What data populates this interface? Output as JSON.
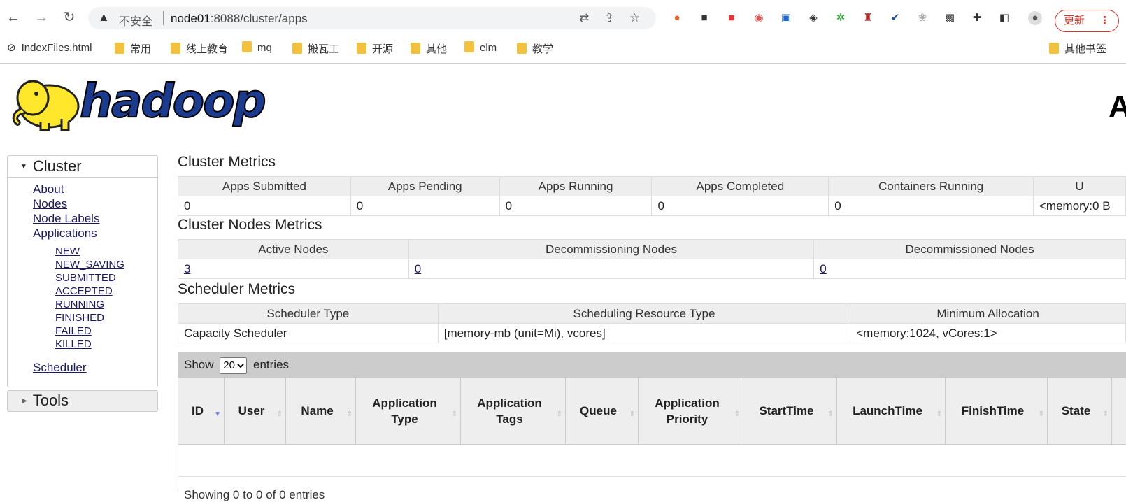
{
  "browser": {
    "back_icon": "←",
    "forward_icon": "→",
    "reload_icon": "↻",
    "insecure_label": "不安全",
    "url_host": "node01",
    "url_rest": ":8088/cluster/apps",
    "update_label": "更新",
    "bookmarks": [
      {
        "label": "IndexFiles.html",
        "icon": "globe-icon"
      },
      {
        "label": "常用",
        "icon": "folder-icon"
      },
      {
        "label": "线上教育",
        "icon": "folder-icon"
      },
      {
        "label": "mq",
        "icon": "folder-icon"
      },
      {
        "label": "搬瓦工",
        "icon": "folder-icon"
      },
      {
        "label": "开源",
        "icon": "folder-icon"
      },
      {
        "label": "其他",
        "icon": "folder-icon"
      },
      {
        "label": "elm",
        "icon": "folder-icon"
      },
      {
        "label": "教学",
        "icon": "folder-icon"
      }
    ],
    "other_bookmarks": "其他书签"
  },
  "page": {
    "logo_text": "hadoop",
    "title_fragment": "A"
  },
  "nav": {
    "cluster_header": "Cluster",
    "links": [
      "About",
      "Nodes",
      "Node Labels",
      "Applications"
    ],
    "app_states": [
      "NEW",
      "NEW_SAVING",
      "SUBMITTED",
      "ACCEPTED",
      "RUNNING",
      "FINISHED",
      "FAILED",
      "KILLED"
    ],
    "scheduler": "Scheduler",
    "tools_header": "Tools"
  },
  "cluster_metrics": {
    "title": "Cluster Metrics",
    "headers": [
      "Apps Submitted",
      "Apps Pending",
      "Apps Running",
      "Apps Completed",
      "Containers Running",
      "U"
    ],
    "values": [
      "0",
      "0",
      "0",
      "0",
      "0",
      "<memory:0 B"
    ]
  },
  "node_metrics": {
    "title": "Cluster Nodes Metrics",
    "headers": [
      "Active Nodes",
      "Decommissioning Nodes",
      "Decommissioned Nodes"
    ],
    "values": [
      "3",
      "0",
      "0"
    ]
  },
  "scheduler_metrics": {
    "title": "Scheduler Metrics",
    "headers": [
      "Scheduler Type",
      "Scheduling Resource Type",
      "Minimum Allocation"
    ],
    "values": [
      "Capacity Scheduler",
      "[memory-mb (unit=Mi), vcores]",
      "<memory:1024, vCores:1>"
    ]
  },
  "apps_table": {
    "show_label": "Show",
    "page_size": "20",
    "entries_label": "entries",
    "columns": [
      "ID",
      "User",
      "Name",
      "Application Type",
      "Application Tags",
      "Queue",
      "Application Priority",
      "StartTime",
      "LaunchTime",
      "FinishTime",
      "State"
    ],
    "footer": "Showing 0 to 0 of 0 entries"
  }
}
